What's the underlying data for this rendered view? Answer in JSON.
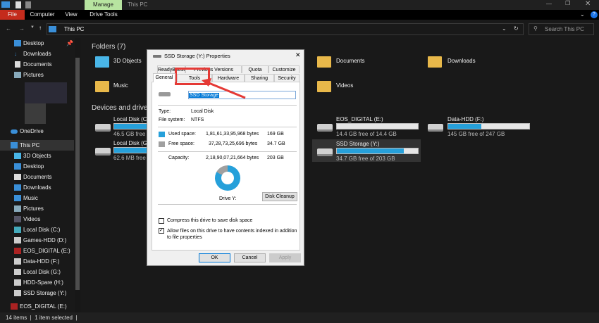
{
  "window": {
    "title": "This PC",
    "ribbon_context_tab": "Manage"
  },
  "ribbon": {
    "tabs": [
      "File",
      "Computer",
      "View",
      "Drive Tools"
    ]
  },
  "address": {
    "path": "This PC",
    "search_placeholder": "Search This PC"
  },
  "sidebar": {
    "quick_access": [
      "Desktop",
      "Downloads",
      "Documents",
      "Pictures"
    ],
    "onedrive": "OneDrive",
    "this_pc": "This PC",
    "items": [
      "3D Objects",
      "Desktop",
      "Documents",
      "Downloads",
      "Music",
      "Pictures",
      "Videos",
      "Local Disk (C:)",
      "Games-HDD (D:)",
      "EOS_DIGITAL (E:)",
      "Data-HDD (F:)",
      "Local Disk (G:)",
      "HDD-Spare (H:)",
      "SSD Storage (Y:)"
    ],
    "bottom": "EOS_DIGITAL (E:)"
  },
  "content": {
    "folders_header": "Folders (7)",
    "folders": [
      "3D Objects",
      "Documents",
      "Downloads",
      "Music",
      "Videos"
    ],
    "drives_header": "Devices and drives",
    "drives": [
      {
        "name": "Local Disk (C:)",
        "free": "46.5 GB free of",
        "used_pct": 80
      },
      {
        "name": "Local Disk (G:)",
        "free": "62.6 MB free o",
        "used_pct": 90
      },
      {
        "name": "EOS_DIGITAL (E:)",
        "free": "14.4 GB free of 14.4 GB",
        "used_pct": 0
      },
      {
        "name": "Data-HDD (F:)",
        "free": "145 GB free of 247 GB",
        "used_pct": 41
      },
      {
        "name": "SSD Storage (Y:)",
        "free": "34.7 GB free of 203 GB",
        "used_pct": 83
      }
    ]
  },
  "dialog": {
    "title": "SSD Storage (Y:) Properties",
    "tabs_row1": [
      "ReadyBoost",
      "Previous Versions",
      "Quota",
      "Customize"
    ],
    "tabs_row2": [
      "General",
      "Tools",
      "Hardware",
      "Sharing",
      "Security"
    ],
    "name_value": "SSD Storage",
    "type_label": "Type:",
    "type_value": "Local Disk",
    "fs_label": "File system:",
    "fs_value": "NTFS",
    "used_label": "Used space:",
    "used_bytes": "1,81,61,33,95,968 bytes",
    "used_gb": "169 GB",
    "free_label": "Free space:",
    "free_bytes": "37,28,73,25,696 bytes",
    "free_gb": "34.7 GB",
    "cap_label": "Capacity:",
    "cap_bytes": "2,18,90,07,21,664 bytes",
    "cap_gb": "203 GB",
    "used_fraction": 0.83,
    "drive_label": "Drive Y:",
    "cleanup": "Disk Cleanup",
    "compress": "Compress this drive to save disk space",
    "index": "Allow files on this drive to have contents indexed in addition to file properties",
    "ok": "OK",
    "cancel": "Cancel",
    "apply": "Apply"
  },
  "status": {
    "items": "14 items",
    "selected": "1 item selected"
  },
  "colors": {
    "accent": "#26a0da",
    "file_tab": "#c42b1c",
    "manage": "#b7e4a0",
    "highlight": "#e53935"
  }
}
